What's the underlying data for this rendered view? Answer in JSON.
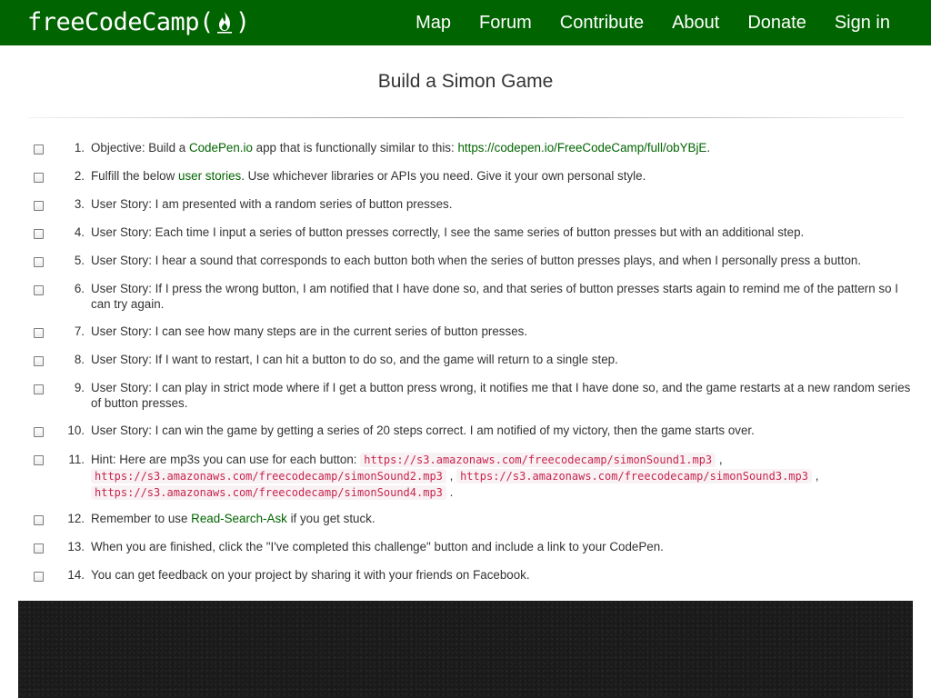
{
  "brand": {
    "name_before": "freeCodeCamp(",
    "name_after": ")",
    "icon": "flame-icon"
  },
  "nav": [
    {
      "label": "Map"
    },
    {
      "label": "Forum"
    },
    {
      "label": "Contribute"
    },
    {
      "label": "About"
    },
    {
      "label": "Donate"
    },
    {
      "label": "Sign in"
    }
  ],
  "page": {
    "title": "Build a Simon Game"
  },
  "steps": [
    {
      "num": "1.",
      "a": "Objective: Build a ",
      "link1": "CodePen.io",
      "b": " app that is functionally similar to this: ",
      "link2": "https://codepen.io/FreeCodeCamp/full/obYBjE",
      "c": "."
    },
    {
      "num": "2.",
      "a": "Fulfill the below ",
      "link1": "user stories",
      "b": ". Use whichever libraries or APIs you need. Give it your own personal style."
    },
    {
      "num": "3.",
      "text": "User Story: I am presented with a random series of button presses."
    },
    {
      "num": "4.",
      "text": "User Story: Each time I input a series of button presses correctly, I see the same series of button presses but with an additional step."
    },
    {
      "num": "5.",
      "text": "User Story: I hear a sound that corresponds to each button both when the series of button presses plays, and when I personally press a button."
    },
    {
      "num": "6.",
      "text": "User Story: If I press the wrong button, I am notified that I have done so, and that series of button presses starts again to remind me of the pattern so I can try again."
    },
    {
      "num": "7.",
      "text": "User Story: I can see how many steps are in the current series of button presses."
    },
    {
      "num": "8.",
      "text": "User Story: If I want to restart, I can hit a button to do so, and the game will return to a single step."
    },
    {
      "num": "9.",
      "text": "User Story: I can play in strict mode where if I get a button press wrong, it notifies me that I have done so, and the game restarts at a new random series of button presses."
    },
    {
      "num": "10.",
      "text": "User Story: I can win the game by getting a series of 20 steps correct. I am notified of my victory, then the game starts over."
    },
    {
      "num": "11.",
      "a": "Hint: Here are mp3s you can use for each button: ",
      "code1": "https://s3.amazonaws.com/freecodecamp/simonSound1.mp3",
      "sep1": " , ",
      "code2": "https://s3.amazonaws.com/freecodecamp/simonSound2.mp3",
      "sep2": " , ",
      "code3": "https://s3.amazonaws.com/freecodecamp/simonSound3.mp3",
      "sep3": " , ",
      "code4": "https://s3.amazonaws.com/freecodecamp/simonSound4.mp3",
      "end": " ."
    },
    {
      "num": "12.",
      "a": "Remember to use ",
      "link1": "Read-Search-Ask",
      "b": " if you get stuck."
    },
    {
      "num": "13.",
      "text": "When you are finished, click the \"I've completed this challenge\" button and include a link to your CodePen."
    },
    {
      "num": "14.",
      "text": "You can get feedback on your project by sharing it with your friends on Facebook."
    }
  ],
  "colors": {
    "navbar": "#006400",
    "link": "#006400",
    "code_text": "#c7254e",
    "code_bg": "#f9f2f4",
    "panel": "#1a1a1a"
  }
}
